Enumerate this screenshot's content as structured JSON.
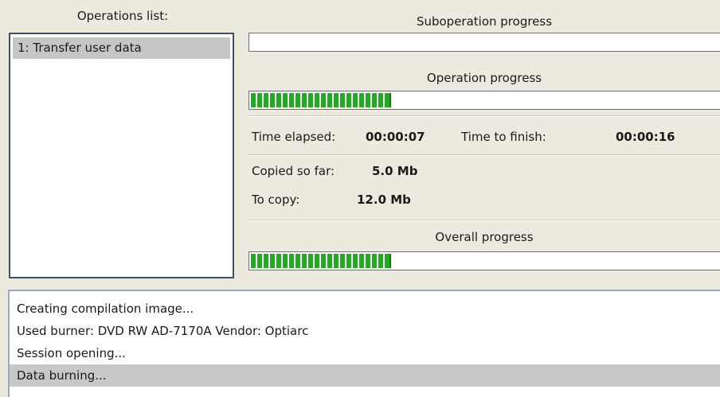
{
  "operations": {
    "title": "Operations list:",
    "items": [
      "1: Transfer user data"
    ]
  },
  "suboperation": {
    "title": "Suboperation progress",
    "progress": 0
  },
  "operation": {
    "title": "Operation progress",
    "progress": 0.29
  },
  "time": {
    "elapsed_label": "Time elapsed:",
    "elapsed_value": "00:00:07",
    "finish_label": "Time to finish:",
    "finish_value": "00:00:16"
  },
  "copy": {
    "copied_label": "Copied so far:",
    "copied_value": "5.0 Mb",
    "tocopy_label": "To copy:",
    "tocopy_value": "12.0 Mb"
  },
  "overall": {
    "title": "Overall progress",
    "progress": 0.29
  },
  "log": {
    "lines": [
      "Creating compilation image...",
      "Used burner: DVD RW AD-7170A   Vendor: Optiarc",
      "Session opening...",
      "Data burning..."
    ],
    "selected_index": 3
  },
  "colors": {
    "progress_fill": "#22aa22",
    "selection": "#c6c6c8",
    "panel_bg": "#ece9de"
  }
}
